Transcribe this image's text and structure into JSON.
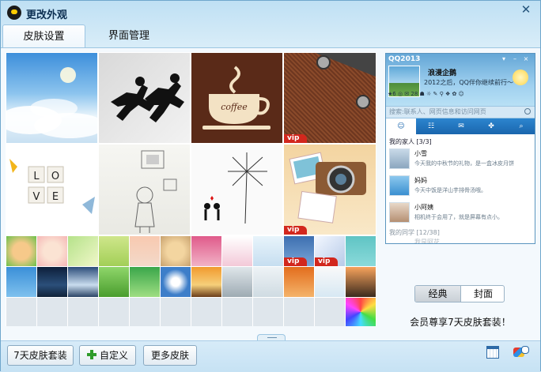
{
  "window": {
    "title": "更改外观",
    "close_glyph": "✕"
  },
  "tabs": [
    {
      "label": "皮肤设置",
      "active": true
    },
    {
      "label": "界面管理",
      "active": false
    }
  ],
  "skins": {
    "vip_label": "vip",
    "large_tiles": [
      {
        "name": "sky-clouds"
      },
      {
        "name": "running-silhouettes"
      },
      {
        "name": "coffee-cup",
        "text": "coffee"
      },
      {
        "name": "leather-rivets",
        "vip": true
      },
      {
        "name": "love-tiles",
        "letters": [
          "L",
          "O",
          "V",
          "E"
        ]
      },
      {
        "name": "sketch-girl-frames"
      },
      {
        "name": "dandelion-couple"
      },
      {
        "name": "vintage-camera",
        "vip": true
      }
    ],
    "small_tiles_row1_vip": [
      8,
      9
    ]
  },
  "preview": {
    "window_title": "QQ2013",
    "nickname": "浪漫企鹅",
    "signature": "2012之后，QQ伴你继续前行～",
    "search_placeholder": "搜索:联系人、网页信息和访问网页",
    "tabs": [
      "☺",
      "☷",
      "✉",
      "✤",
      "⌕"
    ],
    "group1": "我的家人 [3/3]",
    "contacts": [
      {
        "name": "小雪",
        "message": "今天我的中秋节的礼物，是一盒冰皮月饼"
      },
      {
        "name": "妈妈",
        "message": "今天中饭是洋山芋排骨汤哦。"
      },
      {
        "name": "小阿姨",
        "message": "相机终于会用了，就是屏幕有点小。"
      }
    ],
    "group2": "我的同学 [12/38]",
    "faded_contact": "我是阿花"
  },
  "mode_toggle": {
    "options": [
      "经典",
      "封面"
    ],
    "selected": "经典"
  },
  "promo": "会员尊享7天皮肤套装！",
  "buttons": {
    "seven_day": "7天皮肤套装",
    "custom": "自定义",
    "more": "更多皮肤"
  },
  "colors": {
    "accent": "#1a66ad",
    "vip_red": "#d2271d",
    "window_bg": "#cfe6f5"
  }
}
